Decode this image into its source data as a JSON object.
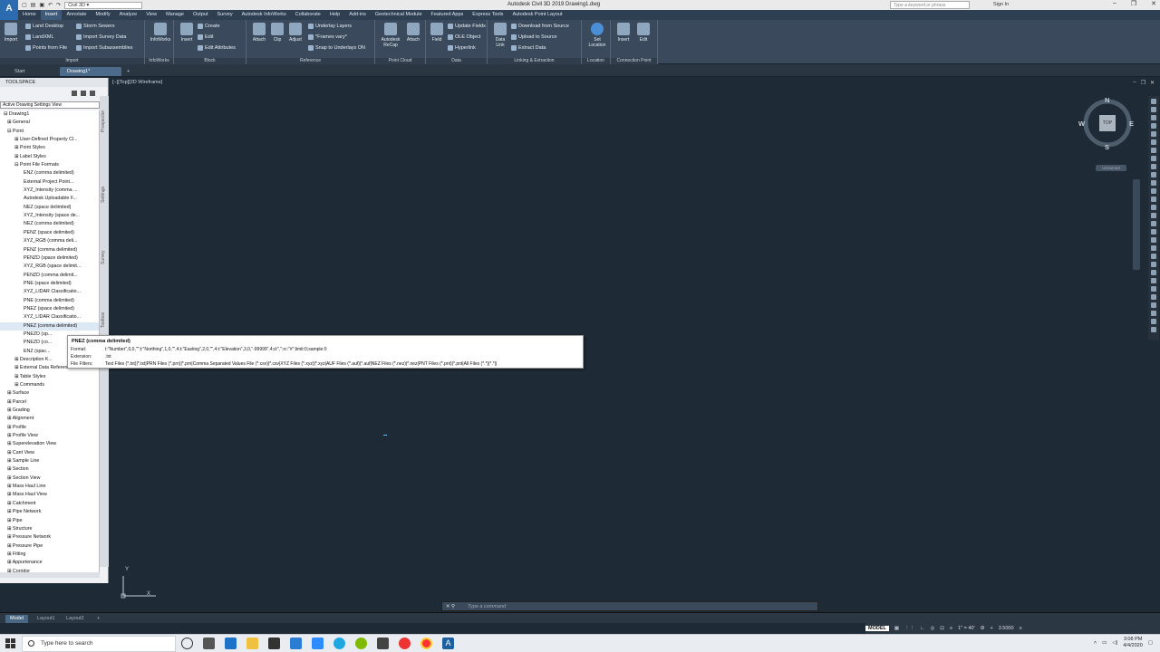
{
  "app": {
    "logo_letter": "A",
    "window_title": "Autodesk Civil 3D 2019    Drawing1.dwg",
    "workspace": "Civil 3D",
    "search_placeholder": "Type a keyword or phrase",
    "sign_in": "Sign In"
  },
  "ribbon_tabs": [
    "Home",
    "Insert",
    "Annotate",
    "Modify",
    "Analyze",
    "View",
    "Manage",
    "Output",
    "Survey",
    "Autodesk InfoWorks",
    "Collaborate",
    "Help",
    "Add-ins",
    "Geotechnical Module",
    "Featured Apps",
    "Express Tools",
    "Autodesk Point Layout"
  ],
  "ribbon": {
    "import": {
      "title": "Import",
      "big": "Import",
      "items": [
        "Land Desktop",
        "LandXML",
        "Points from File",
        "Storm Sewers",
        "Import Survey Data",
        "Import Subassemblies"
      ]
    },
    "infoworks": {
      "title": "InfoWorks",
      "big": "InfoWorks"
    },
    "block": {
      "title": "Block",
      "big": "Insert",
      "items": [
        "Create",
        "Edit",
        "Edit Attributes"
      ]
    },
    "reference": {
      "title": "Reference",
      "bigs": [
        "Attach",
        "Clip",
        "Adjust"
      ],
      "items": [
        "Underlay Layers",
        "*Frames vary*",
        "Snap to Underlays ON"
      ]
    },
    "pointcloud": {
      "title": "Point Cloud",
      "bigs": [
        "Autodesk ReCap",
        "Attach"
      ]
    },
    "data": {
      "title": "Data",
      "big": "Field",
      "items": [
        "Update Fields",
        "OLE Object",
        "Hyperlink"
      ]
    },
    "linking": {
      "title": "Linking & Extraction",
      "big": "Data Link",
      "items": [
        "Download from Source",
        "Upload to Source",
        "Extract  Data"
      ]
    },
    "location": {
      "title": "Location",
      "big": "Set Location"
    },
    "connection": {
      "title": "Connection Point",
      "bigs": [
        "Insert",
        "Edit"
      ]
    }
  },
  "file_tabs": [
    "Start",
    "Drawing1*"
  ],
  "toolspace": {
    "title": "TOOLSPACE",
    "view": "Active Drawing Settings View",
    "side_tabs": [
      "Prospector",
      "Settings",
      "Survey",
      "Toolbox"
    ],
    "tree": [
      "⊟ Drawing1",
      "⊞ General",
      "⊟ Point",
      "⊞ User-Defined Property Cl...",
      "⊞ Point Styles",
      "⊞ Label Styles",
      "⊟ Point File Formats",
      "ENZ (comma delimited)",
      "External Project Point...",
      "XYZ_Intensity (comma ...",
      "Autodesk Uploadable F...",
      "NEZ (space delimited)",
      "XYZ_Intensity (space de...",
      "NEZ (comma delimited)",
      "PENZ (space delimited)",
      "XYZ_RGB (comma deli...",
      "PENZ (comma delimited)",
      "PENZD (space delimited)",
      "XYZ_RGB (space delimit...",
      "PENZD (comma delimit...",
      "PNE (space delimited)",
      "XYZ_LIDAR Classificatio...",
      "PNE (comma delimited)",
      "PNEZ (space delimited)",
      "XYZ_LIDAR Classificatio...",
      "PNEZ (comma delimited)",
      "PNEZD (sp...",
      "PNEZD (co...",
      "ENZ (spac...",
      "⊞ Description K...",
      "⊞ External Data References",
      "⊞ Table Styles",
      "⊞ Commands",
      "⊞ Surface",
      "⊞ Parcel",
      "⊞ Grading",
      "⊞ Alignment",
      "⊞ Profile",
      "⊞ Profile View",
      "⊞ Superelevation View",
      "⊞ Cant View",
      "⊞ Sample Line",
      "⊞ Section",
      "⊞ Section View",
      "⊞ Mass Haul Line",
      "⊞ Mass Haul View",
      "⊞ Catchment",
      "⊞ Pipe Network",
      "⊞ Pipe",
      "⊞ Structure",
      "⊞ Pressure Network",
      "⊞ Pressure Pipe",
      "⊞ Fitting",
      "⊞ Appurtenance",
      "⊞ Corridor"
    ]
  },
  "viewport": {
    "label": "[−][Top][2D Wireframe]",
    "controls": [
      "–",
      "❐",
      "✕"
    ],
    "compass": {
      "N": "N",
      "S": "S",
      "E": "E",
      "W": "W",
      "cube": "TOP"
    },
    "ucs_name": "Unnamed",
    "ucs_x": "X",
    "ucs_y": "Y"
  },
  "tooltip": {
    "title": "PNEZ (comma delimited)",
    "format_label": "Format:",
    "format": "t:\"Number\",0,0,\"\";t:\"Northing\",1,0,\"\",4;t:\"Easting\",2,0,\"\",4;t:\"Elevation\",3,0,\"-99999\",4;d:\",\";rc:\"#\";limit:0;sample:0",
    "ext_label": "Extension:",
    "extension": ".txt",
    "filter_label": "File Filters:",
    "filters": "Text Files (*.txt)|*.txt|PRN Files (*.prn)|*.prn|Comma Separated Values File (*.csv)|*.csv|XYZ Files (*.xyz)|*.xyz|AUF Files (*.auf)|*.auf|NEZ Files (*.nez)|*.nez|PNT Files (*.pnt)|*.pnt|All Files (*.*)|*.*||"
  },
  "command_line": {
    "placeholder": "Type a command"
  },
  "layout_tabs": [
    "Model",
    "Layout1",
    "Layout2"
  ],
  "status": {
    "model": "MODEL",
    "scale": "1\" = 40'",
    "value": "3.5000"
  },
  "taskbar": {
    "search": "Type here to search",
    "time": "3:08 PM",
    "date": "4/4/2020"
  }
}
